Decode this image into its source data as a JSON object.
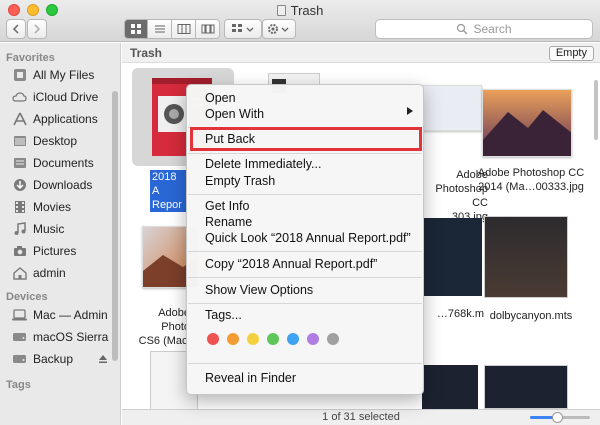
{
  "window": {
    "title": "Trash"
  },
  "toolbar": {
    "search_placeholder": "Search",
    "view_modes": [
      "icon-view",
      "list-view",
      "column-view",
      "gallery-view"
    ]
  },
  "sidebar": {
    "favorites_label": "Favorites",
    "favorites": [
      {
        "label": "All My Files",
        "icon": "all-files-icon"
      },
      {
        "label": "iCloud Drive",
        "icon": "cloud-icon"
      },
      {
        "label": "Applications",
        "icon": "applications-icon"
      },
      {
        "label": "Desktop",
        "icon": "desktop-icon"
      },
      {
        "label": "Documents",
        "icon": "documents-icon"
      },
      {
        "label": "Downloads",
        "icon": "downloads-icon"
      },
      {
        "label": "Movies",
        "icon": "movies-icon"
      },
      {
        "label": "Music",
        "icon": "music-icon"
      },
      {
        "label": "Pictures",
        "icon": "camera-icon"
      },
      {
        "label": "admin",
        "icon": "home-icon"
      }
    ],
    "devices_label": "Devices",
    "devices": [
      {
        "label": "Mac — Admin",
        "icon": "computer-icon"
      },
      {
        "label": "macOS Sierra",
        "icon": "disk-icon"
      },
      {
        "label": "Backup",
        "icon": "disk-icon"
      }
    ],
    "tags_label": "Tags"
  },
  "main": {
    "path_label": "Trash",
    "empty_button": "Empty",
    "files": [
      {
        "label1": "2018 A",
        "label2": "Repor",
        "selected": true
      },
      {
        "label1": "Adobe Photoshop CC",
        "label2": "…303.jpg"
      },
      {
        "label1": "Adobe Photoshop CC",
        "label2": "2014 (Ma…00333.jpg"
      },
      {
        "label1": "Adobe Photo",
        "label2": "CS6 (Maci"
      },
      {
        "label1": "…768k.m",
        "label2": ""
      },
      {
        "label1": "dolbycanyon.mts",
        "label2": ""
      }
    ]
  },
  "context_menu": {
    "items": {
      "open": "Open",
      "open_with": "Open With",
      "put_back": "Put Back",
      "delete_immediately": "Delete Immediately...",
      "empty_trash": "Empty Trash",
      "get_info": "Get Info",
      "rename": "Rename",
      "quick_look": "Quick Look “2018 Annual Report.pdf”",
      "copy": "Copy “2018 Annual Report.pdf”",
      "show_view_options": "Show View Options",
      "tags": "Tags...",
      "reveal_in_finder": "Reveal in Finder"
    },
    "tag_colors": [
      "#ef5350",
      "#f39c34",
      "#f4d03f",
      "#5fc75a",
      "#3ea3f0",
      "#b07ee0",
      "#a0a0a0"
    ]
  },
  "status": {
    "text": "1 of 31 selected",
    "icon_size_fraction": 0.45
  }
}
